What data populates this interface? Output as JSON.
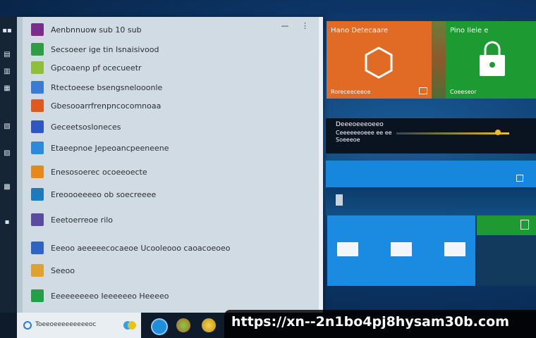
{
  "start_menu": {
    "controls": {
      "minimize": "—",
      "more": "⋮"
    },
    "apps": [
      {
        "label": "Aenbnnuow sub 10 sub",
        "color": "#7b2d8a"
      },
      {
        "label": "Secsoeer ige tin Isnaisivood",
        "color": "#2f9d45"
      },
      {
        "label": "Gpcoaenp pf ocecueetr",
        "color": "#8fbf3a"
      },
      {
        "label": "Rtectoeese bsengsnelooonle",
        "color": "#3a7bd5"
      },
      {
        "label": "Gbesooarrfrenpncocomnoaa",
        "color": "#e05a1c"
      },
      {
        "label": "Geceetsosloneces",
        "color": "#3056c2"
      },
      {
        "label": "Etaeepnoe Jepeoancpeeneene",
        "color": "#2d8ad8"
      },
      {
        "label": "Enesosoerec ocoeeoecte",
        "color": "#e48a1a"
      },
      {
        "label": "Ereoooeeeeo ob soecreeee",
        "color": "#1e7ab8"
      },
      {
        "label": "Eeetoerreoe rilo",
        "color": "#5c4a9e"
      },
      {
        "label": "Eeeoo aeeeeecocaeoe Ucooleooo caoacoeoeo",
        "color": "#3163c4"
      },
      {
        "label": "Seeoo",
        "color": "#e0a22e"
      },
      {
        "label": "Eeeeeeeeeo Ieeeeeeo Heeeeo",
        "color": "#23a046"
      }
    ]
  },
  "tiles": {
    "orange": {
      "title": "Hano Detecaare",
      "footer": "Roreceeceeoe",
      "color": "#e16a25"
    },
    "green": {
      "title": "Pino Iieie e",
      "footer": "Coeeseor",
      "color": "#1d9a32"
    },
    "dark": {
      "title": "Deeeoeeeoeeo",
      "line1": "Ceeeeeeoeee ee ee",
      "line2": "Soeeeoe"
    }
  },
  "taskbar": {
    "search_placeholder": "Toeeoeeeeeeeeeoc"
  },
  "url_banner": "https://xn--2n1bo4pj8hysam30b.com"
}
